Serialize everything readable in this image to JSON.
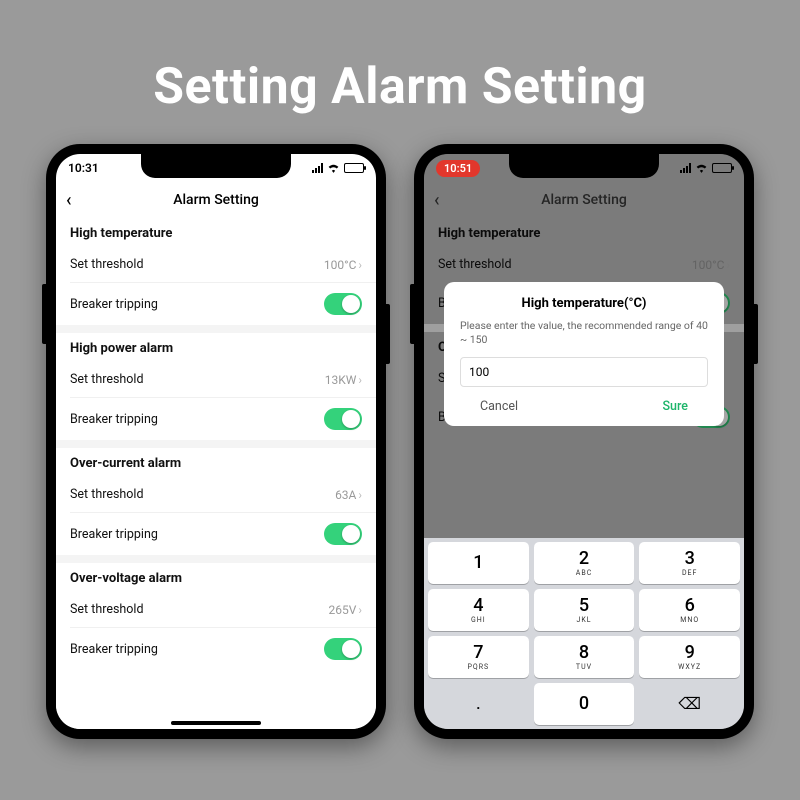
{
  "banner": "Setting Alarm Setting",
  "phone1": {
    "time": "10:31",
    "navTitle": "Alarm Setting",
    "sections": [
      {
        "title": "High temperature",
        "threshold_label": "Set threshold",
        "threshold_value": "100°C",
        "breaker_label": "Breaker tripping",
        "breaker_on": true
      },
      {
        "title": "High power alarm",
        "threshold_label": "Set threshold",
        "threshold_value": "13KW",
        "breaker_label": "Breaker tripping",
        "breaker_on": true
      },
      {
        "title": "Over-current alarm",
        "threshold_label": "Set threshold",
        "threshold_value": "63A",
        "breaker_label": "Breaker tripping",
        "breaker_on": true
      },
      {
        "title": "Over-voltage alarm",
        "threshold_label": "Set threshold",
        "threshold_value": "265V",
        "breaker_label": "Breaker tripping",
        "breaker_on": true
      }
    ]
  },
  "phone2": {
    "time": "10:51",
    "navTitle": "Alarm Setting",
    "sections": [
      {
        "title": "High temperature",
        "threshold_label": "Set threshold",
        "threshold_value": "100°C",
        "breaker_label": "Breaker tripping"
      },
      {
        "title": "Over-voltage alarm",
        "threshold_label": "Set threshold",
        "breaker_label": "Breaker tripping"
      }
    ],
    "modal": {
      "title": "High temperature(°C)",
      "hint": "Please enter the value, the recommended range of 40 ~ 150",
      "value": "100",
      "cancel": "Cancel",
      "sure": "Sure"
    },
    "keypad": [
      [
        {
          "n": "1",
          "s": ""
        },
        {
          "n": "2",
          "s": "ABC"
        },
        {
          "n": "3",
          "s": "DEF"
        }
      ],
      [
        {
          "n": "4",
          "s": "GHI"
        },
        {
          "n": "5",
          "s": "JKL"
        },
        {
          "n": "6",
          "s": "MNO"
        }
      ],
      [
        {
          "n": "7",
          "s": "PQRS"
        },
        {
          "n": "8",
          "s": "TUV"
        },
        {
          "n": "9",
          "s": "WXYZ"
        }
      ],
      [
        {
          "n": ".",
          "s": "",
          "util": true
        },
        {
          "n": "0",
          "s": ""
        },
        {
          "n": "⌫",
          "s": "",
          "util": true
        }
      ]
    ]
  }
}
